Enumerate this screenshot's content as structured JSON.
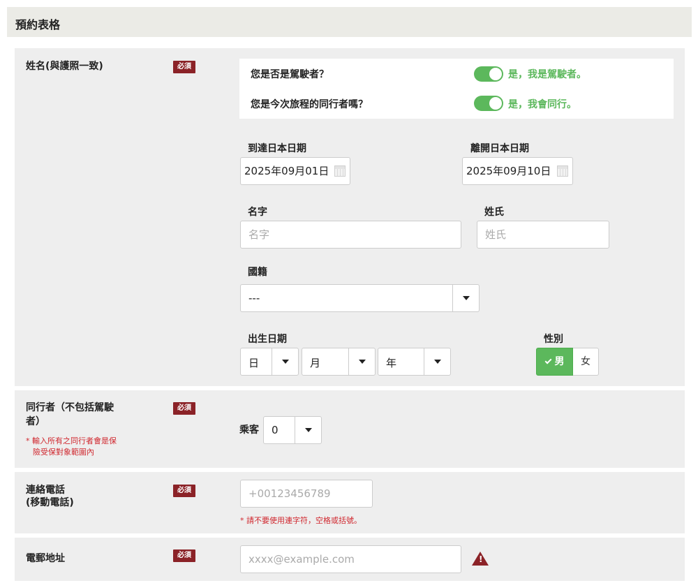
{
  "form": {
    "title": "預約表格"
  },
  "required_badge": "必須",
  "name_section": {
    "label": "姓名(與護照一致)",
    "q_driver": {
      "text": "您是否是駕駛者？",
      "answer": "是，我是駕駛者。",
      "on": true
    },
    "q_companion": {
      "text": "您是今次旅程的同行者嗎？",
      "answer": "是，我會同行。",
      "on": true
    },
    "arrival": {
      "label": "到達日本日期",
      "value": "2025年09月01日"
    },
    "departure": {
      "label": "離開日本日期",
      "value": "2025年09月10日"
    },
    "first_name": {
      "label": "名字",
      "placeholder": "名字",
      "value": ""
    },
    "last_name": {
      "label": "姓氏",
      "placeholder": "姓氏",
      "value": ""
    },
    "nationality": {
      "label": "國籍",
      "value": "---"
    },
    "dob": {
      "label": "出生日期",
      "day": "日",
      "month": "月",
      "year": "年"
    },
    "gender": {
      "label": "性別",
      "male": "男",
      "female": "女",
      "selected": "男"
    }
  },
  "companions": {
    "label_line1": "同行者（不包括駕駛",
    "label_line2": "者）",
    "note_line1": "* 輸入所有之同行者會是保",
    "note_line2": "險受保對象範圍內",
    "passengers_label": "乘客",
    "passengers_value": "0"
  },
  "phone": {
    "label_line1": "連絡電話",
    "label_line2": "(移動電話)",
    "placeholder": "+00123456789",
    "note": "* 請不要使用連字符，空格或括號。"
  },
  "email": {
    "label": "電郵地址",
    "placeholder": "xxxx@example.com"
  },
  "colors": {
    "accent": "#5cb85c",
    "required": "#8b2227",
    "error_note": "#d0282f",
    "section_bg": "#eeeeee"
  }
}
